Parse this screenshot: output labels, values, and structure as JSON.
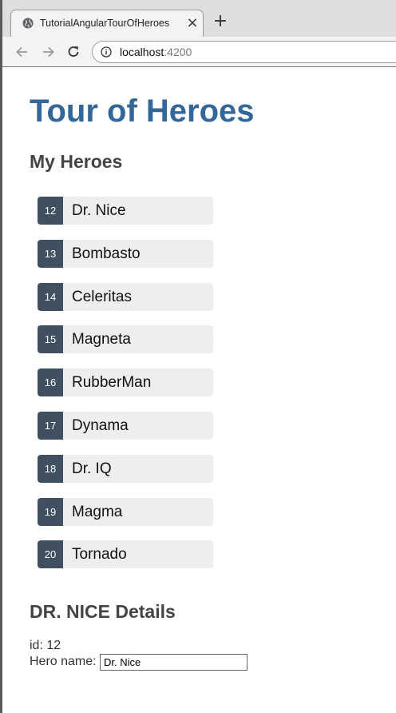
{
  "browser": {
    "tab": {
      "title": "TutorialAngularTourOfHeroes",
      "favicon": "globe-icon",
      "close_glyph": "×"
    },
    "new_tab_glyph": "+",
    "address": {
      "host": "localhost",
      "port": ":4200"
    }
  },
  "app": {
    "title": "Tour of Heroes",
    "heroes_heading": "My Heroes",
    "heroes": [
      {
        "id": "12",
        "name": "Dr. Nice"
      },
      {
        "id": "13",
        "name": "Bombasto"
      },
      {
        "id": "14",
        "name": "Celeritas"
      },
      {
        "id": "15",
        "name": "Magneta"
      },
      {
        "id": "16",
        "name": "RubberMan"
      },
      {
        "id": "17",
        "name": "Dynama"
      },
      {
        "id": "18",
        "name": "Dr. IQ"
      },
      {
        "id": "19",
        "name": "Magma"
      },
      {
        "id": "20",
        "name": "Tornado"
      }
    ],
    "details": {
      "heading": "DR. NICE Details",
      "id_line": "id: 12",
      "name_label": "Hero name:",
      "name_value": "Dr. Nice"
    }
  },
  "colors": {
    "title": "#336699",
    "badge": "#405061",
    "item_bg": "#eeeeee"
  }
}
